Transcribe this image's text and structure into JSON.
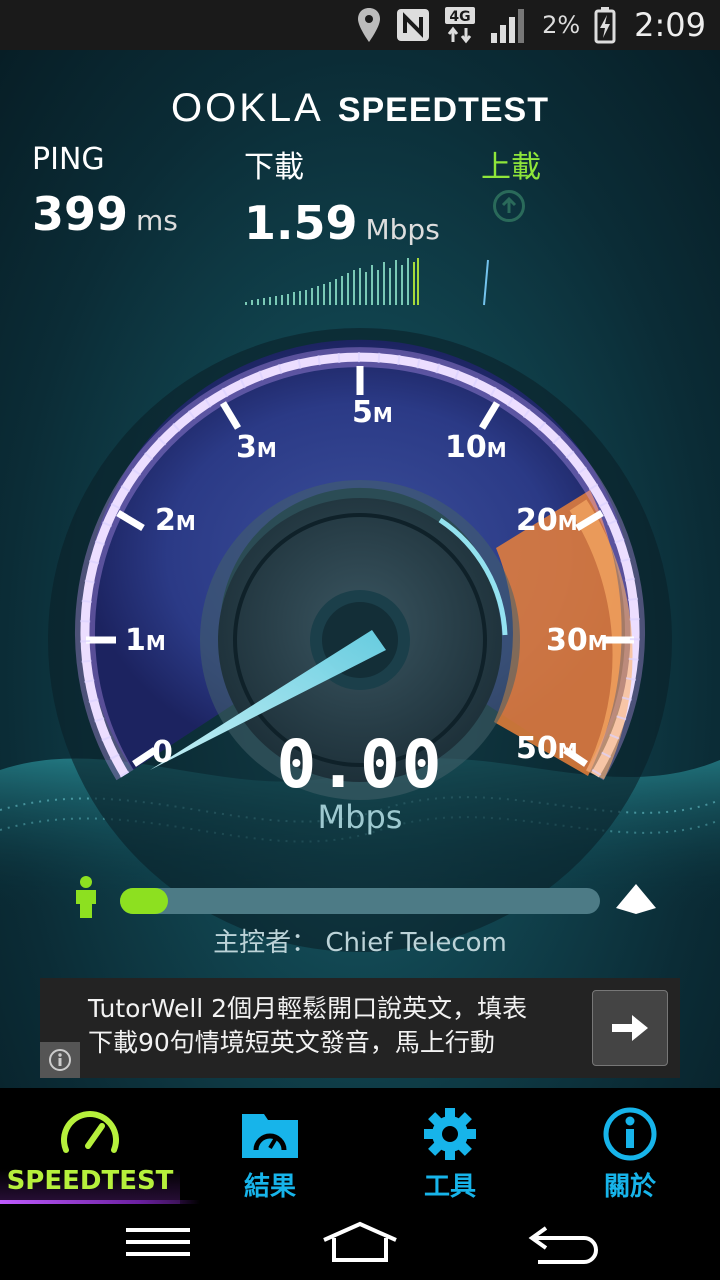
{
  "status_bar": {
    "network": "4G",
    "battery": "2%",
    "time": "2:09"
  },
  "brand": {
    "ookla": "OOKLA",
    "speedtest": "SPEEDTEST"
  },
  "metrics": {
    "ping": {
      "label": "PING",
      "value": "399",
      "unit": "ms"
    },
    "download": {
      "label": "下載",
      "value": "1.59",
      "unit": "Mbps"
    },
    "upload": {
      "label": "上載"
    }
  },
  "gauge": {
    "ticks": [
      {
        "num": "0",
        "suffix": ""
      },
      {
        "num": "1",
        "suffix": "M"
      },
      {
        "num": "2",
        "suffix": "M"
      },
      {
        "num": "3",
        "suffix": "M"
      },
      {
        "num": "5",
        "suffix": "M"
      },
      {
        "num": "10",
        "suffix": "M"
      },
      {
        "num": "20",
        "suffix": "M"
      },
      {
        "num": "30",
        "suffix": "M"
      },
      {
        "num": "50",
        "suffix": "M"
      }
    ],
    "speed_value": "0.00",
    "speed_unit": "Mbps"
  },
  "progress": {
    "fraction": 0.1,
    "host_label": "主控者：",
    "host_name": "Chief Telecom"
  },
  "ad": {
    "line1": "TutorWell 2個月輕鬆開口說英文，填表",
    "line2": "下載90句情境短英文發音，馬上行動"
  },
  "tabs": [
    {
      "label": "SPEEDTEST",
      "icon": "speedometer-icon",
      "active": true
    },
    {
      "label": "結果",
      "icon": "folder-gauge-icon",
      "active": false
    },
    {
      "label": "工具",
      "icon": "gear-icon",
      "active": false
    },
    {
      "label": "關於",
      "icon": "info-icon",
      "active": false
    }
  ],
  "colors": {
    "accent_green": "#8de020",
    "tab_blue": "#17b4ea",
    "active_tab_text": "#b6f03c",
    "gauge_orange": "#f08a3c",
    "gauge_purple": "#b07cff"
  }
}
